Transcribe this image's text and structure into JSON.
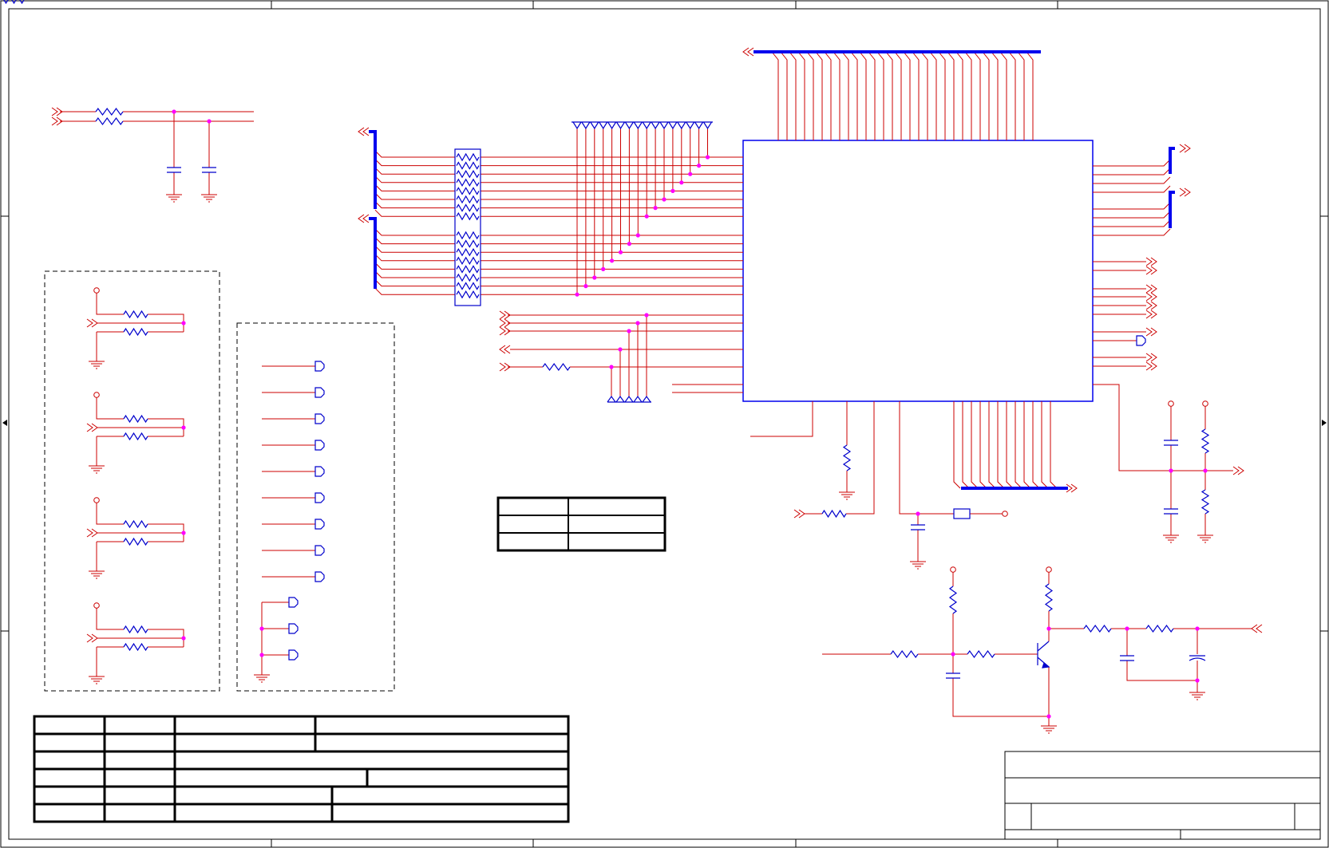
{
  "sheet": {
    "colors": {
      "wire": "#cc0000",
      "bus": "#0000ee",
      "component": "#0000cc",
      "junction": "#ff00ff",
      "border": "#000000",
      "background": "#ffffff"
    },
    "labels": {}
  },
  "icons": [
    "offpage-connector-icon",
    "ground-icon",
    "power-rail-icon",
    "resistor-icon",
    "capacitor-icon",
    "transistor-icon",
    "crystal-icon",
    "port-icon"
  ]
}
